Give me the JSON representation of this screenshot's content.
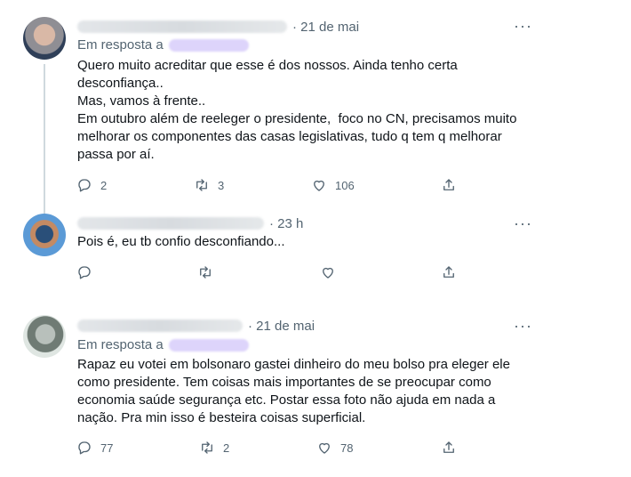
{
  "tweets": [
    {
      "time": "· 21 de mai",
      "reply_prefix": "Em resposta a",
      "text": "Quero muito acreditar que esse é dos nossos. Ainda tenho certa\ndesconfiança..\nMas, vamos à frente..\nEm outubro além de reeleger o presidente,  foco no CN, precisamos muito\nmelhorar os componentes das casas legislativas, tudo q tem q melhorar\npassa por aí.",
      "replies": "2",
      "retweets": "3",
      "likes": "106"
    },
    {
      "time": "· 23 h",
      "text": "Pois é, eu tb confio desconfiando...",
      "replies": "",
      "retweets": "",
      "likes": ""
    },
    {
      "time": "· 21 de mai",
      "reply_prefix": "Em resposta a",
      "text": "Rapaz eu votei em bolsonaro gastei dinheiro do meu bolso pra eleger ele\ncomo presidente. Tem coisas mais importantes de se preocupar como\neconomia saúde segurança etc. Postar essa foto não ajuda em nada a\nnação. Pra min isso é besteira coisas superficial.",
      "replies": "77",
      "retweets": "2",
      "likes": "78"
    }
  ],
  "more_glyph": "···",
  "icons": [
    "reply-icon",
    "retweet-icon",
    "like-icon",
    "share-icon",
    "more-icon"
  ]
}
